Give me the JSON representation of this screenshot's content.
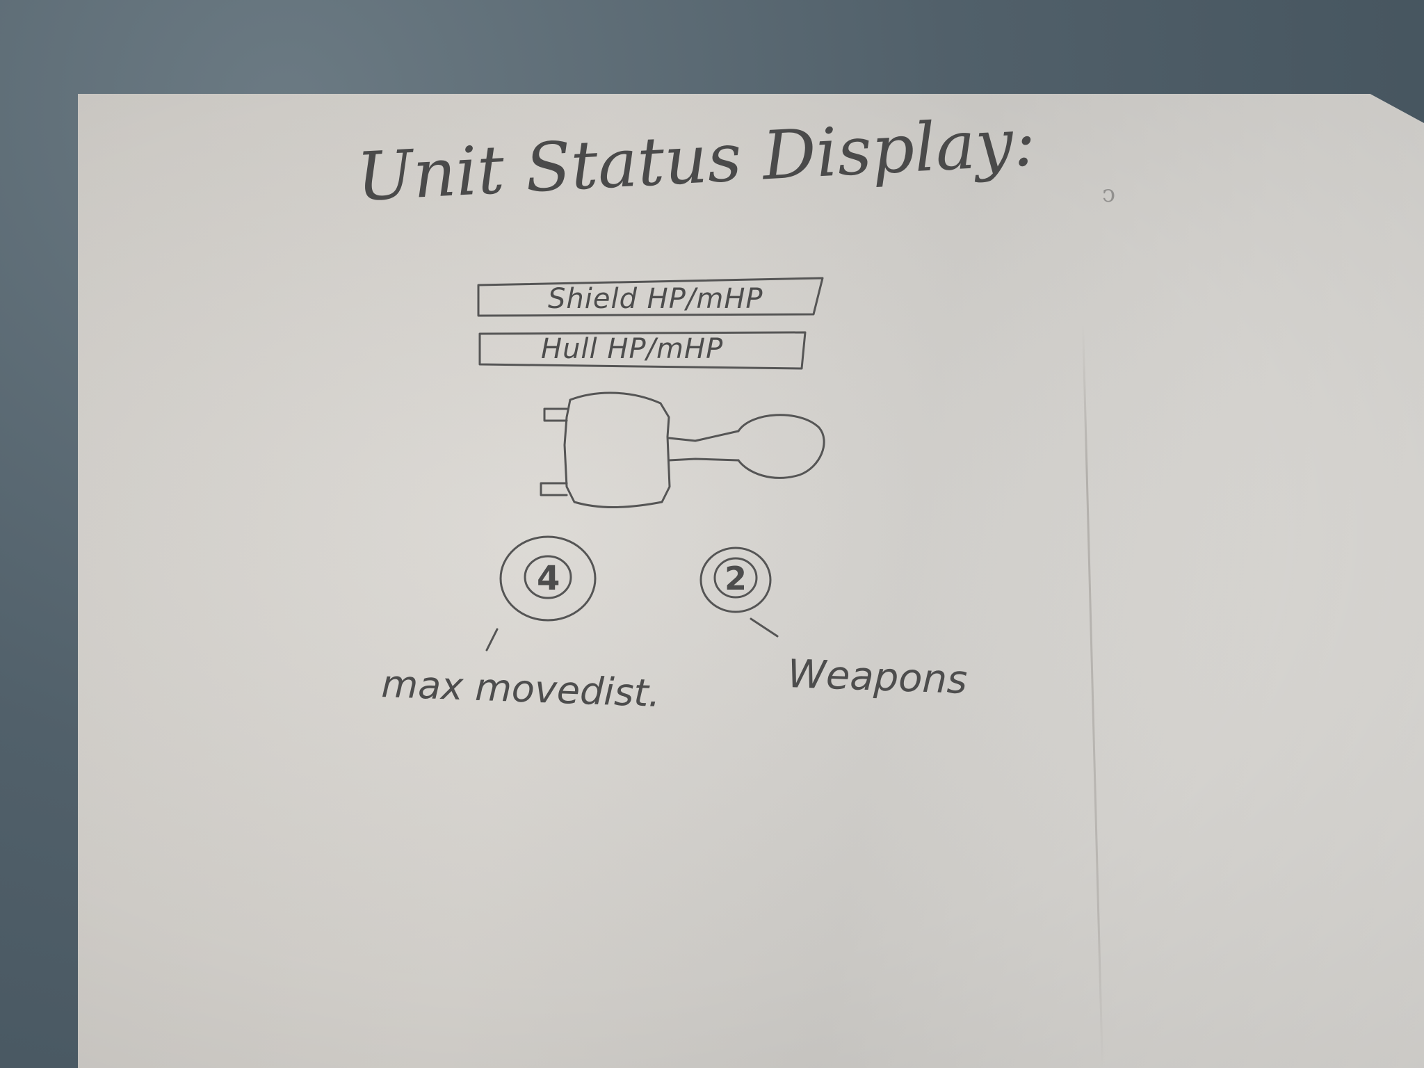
{
  "sketch": {
    "title": "Unit Status Display:",
    "bars": [
      {
        "label": "Shield HP/mHP"
      },
      {
        "label": "Hull HP/mHP"
      }
    ],
    "badges": [
      {
        "value": "4",
        "caption": "max movedist."
      },
      {
        "value": "2",
        "caption": "Weapons"
      }
    ]
  },
  "colors": {
    "paper": "#d7d4cf",
    "background": "#51606a",
    "ink": "#4a4a4a"
  }
}
